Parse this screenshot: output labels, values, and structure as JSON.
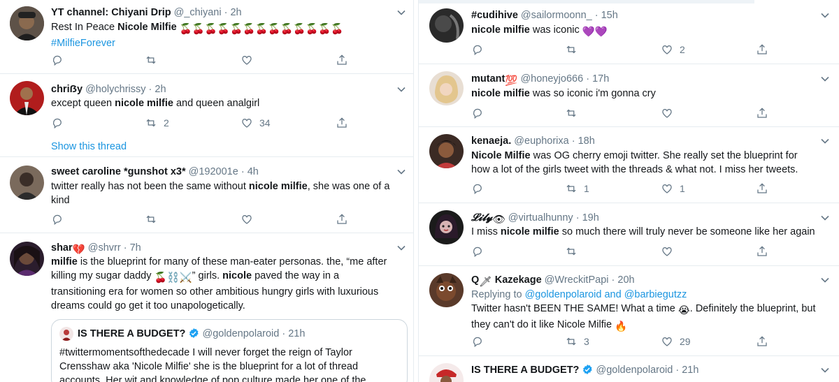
{
  "left": [
    {
      "name": "YT channel: Chiyani Drip",
      "handle": "@_chiyani",
      "time": "2h",
      "text_plain": "Rest In Peace ",
      "text_bold": "Nicole Milfie",
      "emoji": "🍒🍒🍒🍒🍒🍒🍒🍒🍒🍒🍒🍒🍒",
      "hashtag": "#MilfieForever",
      "reply_count": "",
      "retweet_count": "",
      "like_count": ""
    },
    {
      "name": "chriẞy",
      "handle": "@holychrissy",
      "time": "2h",
      "text_a": "except queen ",
      "text_bold": "nicole milfie",
      "text_b": " and queen analgirl",
      "retweet_count": "2",
      "like_count": "34",
      "show_thread": "Show this thread"
    },
    {
      "name": "sweet caroline *gunshot x3*",
      "handle": "@192001e",
      "time": "4h",
      "text_a": "twitter really has not been the same without ",
      "text_bold": "nicole milfie",
      "text_b": ", she was one of a",
      "text_line2": "kind"
    },
    {
      "name": "shar",
      "name_emoji": "💔",
      "handle": "@shvrr",
      "time": "7h",
      "line1_bold": "milfie",
      "line1": " is the blueprint for many of these man-eater personas. the, “me after",
      "line2a": "killing my sugar daddy ",
      "line2_emoji": "🍒⛓️⚔️",
      "line2b": "” girls. ",
      "line2_bold": "nicole",
      "line2c": " paved the way in a",
      "line3": "transitioning era for women so other ambitious hungry girls with luxurious",
      "line4": "dreams could go get it too unapologetically.",
      "quote": {
        "name": "IS THERE A BUDGET?",
        "handle": "@goldenpolaroid",
        "time": "21h",
        "line1": "#twittermomentsofthedecade I will never forget the reign of Taylor",
        "line2": "Crensshaw aka 'Nicole Milfie' she is the blueprint for a lot of thread",
        "line3": "accounts. Her wit and knowledge of pop culture made her one of the"
      }
    }
  ],
  "right": [
    {
      "name": "#cudihive",
      "handle": "@sailormoonn_",
      "time": "15h",
      "text_bold": "nicole milfie",
      "text_a": " was iconic ",
      "text_emoji": "💜💜",
      "like_count": "2"
    },
    {
      "name": "mutant",
      "name_emoji": "💯",
      "handle": "@honeyjo666",
      "time": "17h",
      "text_bold": "nicole milfie",
      "text_a": " was so iconic i'm gonna cry"
    },
    {
      "name": "kenaeja.",
      "handle": "@euphorixa",
      "time": "18h",
      "text_bold": "Nicole Milfie",
      "text_a": " was OG cherry emoji twitter. She really set the blueprint for",
      "text_line2": "how a lot of the girls tweet with the threads & what not. I miss her tweets.",
      "retweet_count": "1",
      "like_count": "1"
    },
    {
      "name": "𝓛𝓲𝓵𝔂",
      "name_emoji": "👁",
      "handle": "@virtualhunny",
      "time": "19h",
      "text_a": "I miss ",
      "text_bold": "nicole milfie",
      "text_b": " so much there will truly never be someone like her again"
    },
    {
      "name_prefix": "Q",
      "name_emoji": "🗡",
      "name": " Kazekage",
      "handle": "@WreckitPapi",
      "time": "20h",
      "replying_label": "Replying to ",
      "replying_1": "@goldenpolaroid",
      "replying_and": " and ",
      "replying_2": "@barbiegutzz",
      "line1": "Twitter hasn't BEEN THE SAME! What a time ",
      "line1_emoji": "😭",
      "line1b": ". Definitely the blueprint, but",
      "line2": "they can't do it like Nicole Milfie ",
      "line2_emoji": "🔥",
      "retweet_count": "3",
      "like_count": "29"
    },
    {
      "name": "IS THERE A BUDGET?",
      "handle": "@goldenpolaroid",
      "time": "21h"
    }
  ],
  "colors": {
    "link": "#1b95e0",
    "muted": "#657786",
    "border": "#e6ecf0",
    "verified": "#1da1f2"
  },
  "icons": [
    "reply-icon",
    "retweet-icon",
    "like-icon",
    "share-icon",
    "chevron-down-icon",
    "verified-icon"
  ]
}
